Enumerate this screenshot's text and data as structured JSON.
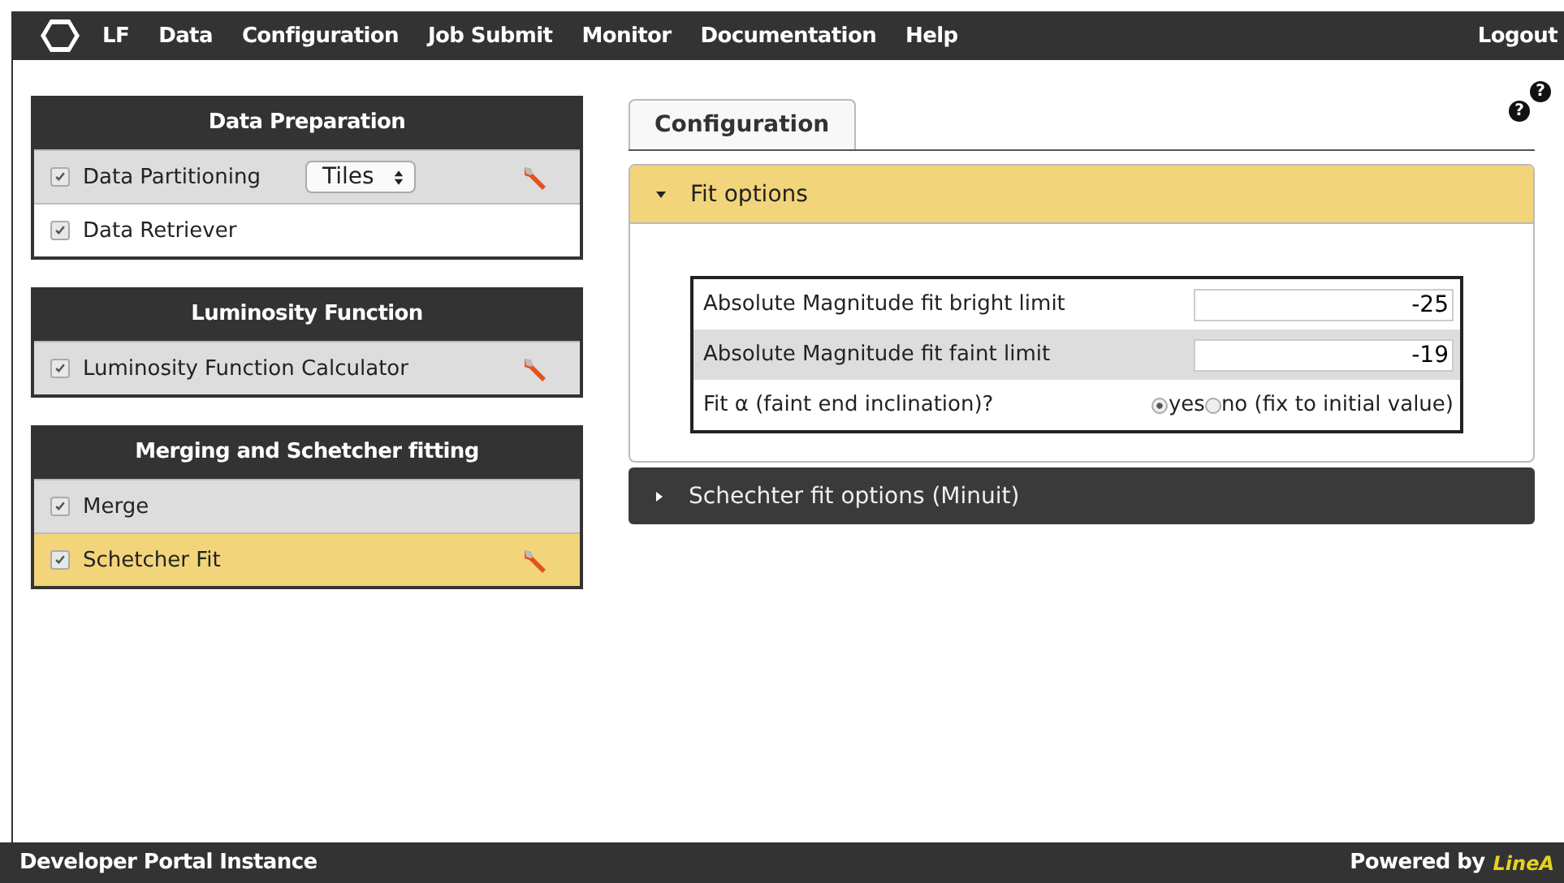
{
  "navbar": {
    "items": [
      "LF",
      "Data",
      "Configuration",
      "Job Submit",
      "Monitor",
      "Documentation",
      "Help"
    ],
    "logout": "Logout"
  },
  "panels": [
    {
      "title": "Data Preparation",
      "items": [
        {
          "label": "Data Partitioning",
          "checked": true,
          "selected": false,
          "select": "Tiles",
          "tool": true
        },
        {
          "label": "Data Retriever",
          "checked": true,
          "selected": false,
          "tool": false
        }
      ]
    },
    {
      "title": "Luminosity Function",
      "items": [
        {
          "label": "Luminosity Function Calculator",
          "checked": true,
          "selected": false,
          "tool": true
        }
      ]
    },
    {
      "title": "Merging and Schetcher fitting",
      "items": [
        {
          "label": "Merge",
          "checked": true,
          "selected": false,
          "tool": false
        },
        {
          "label": "Schetcher Fit",
          "checked": true,
          "selected": true,
          "tool": true
        }
      ]
    }
  ],
  "help_icons": [
    "?",
    "?"
  ],
  "tabs": [
    {
      "label": "Configuration",
      "selected": true
    }
  ],
  "sections": [
    {
      "title": "Fit options",
      "expanded": true,
      "fields": [
        {
          "kind": "input",
          "label": "Absolute Magnitude fit bright limit",
          "value": "-25"
        },
        {
          "kind": "input",
          "label": "Absolute Magnitude fit faint limit",
          "value": "-19"
        },
        {
          "kind": "radio",
          "label": "Fit α (faint end inclination)?",
          "options": [
            {
              "label": "yes",
              "selected": true
            },
            {
              "label": "no (fix to initial value)",
              "selected": false
            }
          ]
        }
      ]
    },
    {
      "title": "Schechter fit options (Minuit)",
      "expanded": false
    }
  ],
  "footer": {
    "left": "Developer Portal Instance",
    "powered": "Powered by",
    "logo": "LineA"
  }
}
